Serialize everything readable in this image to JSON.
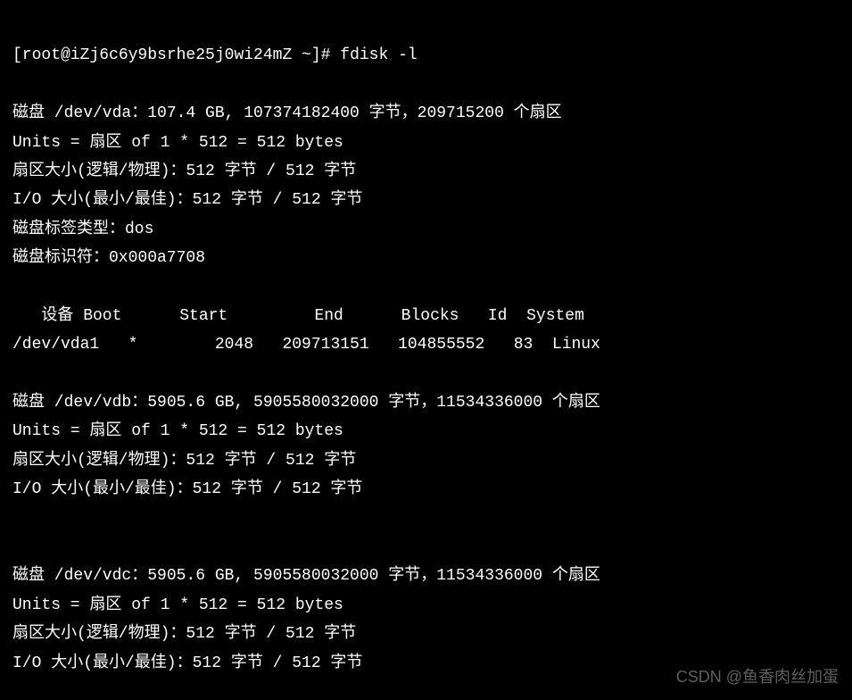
{
  "prompt": {
    "text": "[root@iZj6c6y9bsrhe25j0wi24mZ ~]#",
    "command": "fdisk -l"
  },
  "disks": [
    {
      "header": "磁盘 /dev/vda：107.4 GB, 107374182400 字节，209715200 个扇区",
      "units": "Units = 扇区 of 1 * 512 = 512 bytes",
      "sector_size": "扇区大小(逻辑/物理)：512 字节 / 512 字节",
      "io_size": "I/O 大小(最小/最佳)：512 字节 / 512 字节",
      "label_type": "磁盘标签类型：dos",
      "identifier": "磁盘标识符：0x000a7708"
    },
    {
      "header": "磁盘 /dev/vdb：5905.6 GB, 5905580032000 字节，11534336000 个扇区",
      "units": "Units = 扇区 of 1 * 512 = 512 bytes",
      "sector_size": "扇区大小(逻辑/物理)：512 字节 / 512 字节",
      "io_size": "I/O 大小(最小/最佳)：512 字节 / 512 字节"
    },
    {
      "header": "磁盘 /dev/vdc：5905.6 GB, 5905580032000 字节，11534336000 个扇区",
      "units": "Units = 扇区 of 1 * 512 = 512 bytes",
      "sector_size": "扇区大小(逻辑/物理)：512 字节 / 512 字节",
      "io_size": "I/O 大小(最小/最佳)：512 字节 / 512 字节"
    }
  ],
  "partition_header": "   设备 Boot      Start         End      Blocks   Id  System",
  "partitions": [
    "/dev/vda1   *        2048   209713151   104855552   83  Linux"
  ],
  "watermark": "CSDN @鱼香肉丝加蛋"
}
